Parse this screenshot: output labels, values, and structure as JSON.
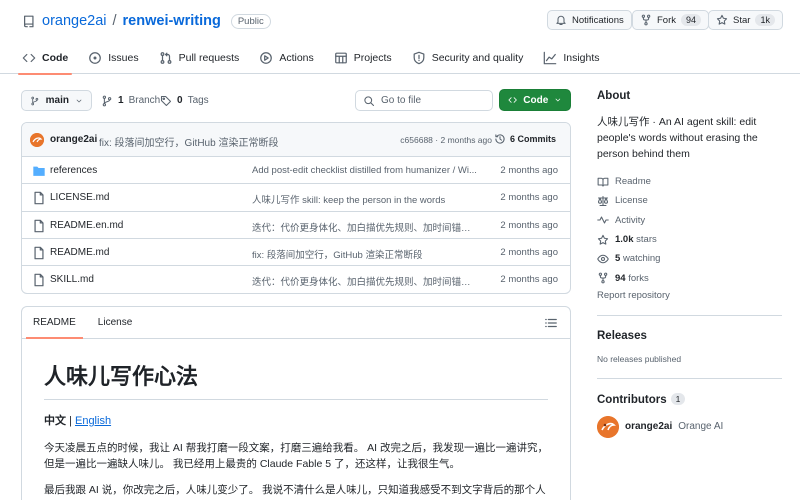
{
  "repo": {
    "owner": "orange2ai",
    "separator": "/",
    "name": "renwei-writing",
    "visibility": "Public"
  },
  "header_buttons": {
    "notifications": "Notifications",
    "fork_label": "Fork",
    "fork_count": "94",
    "star_label": "Star",
    "star_count": "1k"
  },
  "nav": {
    "code": "Code",
    "issues": "Issues",
    "pull_requests": "Pull requests",
    "actions": "Actions",
    "projects": "Projects",
    "security": "Security and quality",
    "insights": "Insights"
  },
  "toolbar": {
    "branch": "main",
    "branch_count": "1",
    "branch_word": "Branch",
    "tag_count": "0",
    "tag_word": "Tags",
    "search_placeholder": "Go to file",
    "code_button": "Code"
  },
  "latest_commit": {
    "author": "orange2ai",
    "message": "fix: 段落间加空行，GitHub 渲染正常断段",
    "hash": "c656688",
    "time": "2 months ago",
    "commits": "6 Commits"
  },
  "files": [
    {
      "name": "references",
      "type": "folder",
      "message": "Add post-edit checklist distilled from humanizer / Wi...",
      "date": "2 months ago"
    },
    {
      "name": "LICENSE.md",
      "type": "file",
      "message": "人味儿写作 skill: keep the person in the words",
      "date": "2 months ago"
    },
    {
      "name": "README.en.md",
      "type": "file",
      "message": "迭代：代价更身体化、加白描优先规则、加时间锚点g...",
      "date": "2 months ago"
    },
    {
      "name": "README.md",
      "type": "file",
      "message": "fix: 段落间加空行，GitHub 渲染正常断段",
      "date": "2 months ago"
    },
    {
      "name": "SKILL.md",
      "type": "file",
      "message": "迭代：代价更身体化、加白描优先规则、加时间锚点g...",
      "date": "2 months ago"
    }
  ],
  "readme": {
    "tab_readme": "README",
    "tab_license": "License",
    "title": "人味儿写作心法",
    "lang_current": "中文",
    "lang_sep": " | ",
    "lang_other": "English",
    "p1": "今天凌晨五点的时候，我让 AI 帮我打磨一段文案，打磨三遍给我看。 AI 改完之后，我发现一遍比一遍讲究，但是一遍比一遍缺人味儿。 我已经用上最贵的 Claude Fable 5 了，还这样，让我很生气。",
    "p2": "最后我跟 AI 说，你改完之后，人味儿变少了。 我说不清什么是人味儿，只知道我感受不到文字背后的那个人了。"
  },
  "about": {
    "heading": "About",
    "description": "人味儿写作 · An AI agent skill: edit people's words without erasing the person behind them",
    "readme": "Readme",
    "license": "License",
    "activity": "Activity",
    "stars_num": "1.0k",
    "stars_word": "stars",
    "watching_num": "5",
    "watching_word": "watching",
    "forks_num": "94",
    "forks_word": "forks",
    "report": "Report repository"
  },
  "releases": {
    "heading": "Releases",
    "empty": "No releases published"
  },
  "contributors": {
    "heading": "Contributors",
    "count": "1",
    "handle": "orange2ai",
    "display_name": "Orange AI"
  }
}
